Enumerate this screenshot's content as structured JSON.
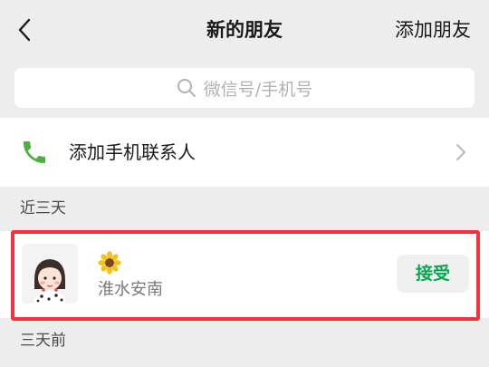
{
  "nav": {
    "back_icon": "chevron-left-icon",
    "title": "新的朋友",
    "action_label": "添加朋友"
  },
  "search": {
    "icon": "search-icon",
    "placeholder": "微信号/手机号"
  },
  "add_contacts": {
    "icon": "phone-icon",
    "label": "添加手机联系人",
    "chevron_icon": "chevron-right-icon",
    "icon_color": "#4cb13c"
  },
  "sections": [
    {
      "header": "近三天",
      "items": [
        {
          "avatar": "avatar-image",
          "nickname_icon": "sunflower-emoji-icon",
          "name": "淮水安南",
          "action_label": "接受"
        }
      ]
    },
    {
      "header": "三天前"
    }
  ],
  "colors": {
    "accent": "#07a852",
    "highlight_border": "#f5323c",
    "background": "#ededed"
  }
}
